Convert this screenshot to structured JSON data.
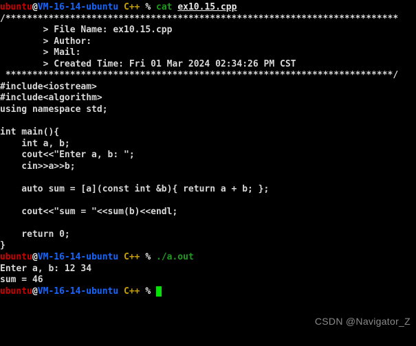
{
  "terminal": {
    "background_color": "#000000",
    "foreground_color": "#d8d8d8",
    "cursor_color": "#00e500",
    "colors": {
      "user": "#cc0000",
      "host": "#1565ff",
      "dir": "#c8a000",
      "command": "#1f9c1f",
      "text": "#e0e0e0"
    },
    "prompt": {
      "user": "ubuntu",
      "at": "@",
      "host": "VM-16-14-ubuntu",
      "dir": "C++",
      "symbol": "%"
    },
    "commands": {
      "cat": "cat",
      "cat_arg": "ex10.15.cpp",
      "run": "./a.out"
    },
    "source_file": {
      "header_open": "/*************************************************************************",
      "header_lines": [
        "        > File Name: ex10.15.cpp",
        "        > Author: ",
        "        > Mail: ",
        "        > Created Time: Fri 01 Mar 2024 02:34:26 PM CST"
      ],
      "header_close": " ************************************************************************/",
      "code_lines": [
        "#include<iostream>",
        "#include<algorithm>",
        "using namespace std;",
        "",
        "int main(){",
        "    int a, b;",
        "    cout<<\"Enter a, b: \";",
        "    cin>>a>>b;",
        "",
        "    auto sum = [a](const int &b){ return a + b; };",
        "",
        "    cout<<\"sum = \"<<sum(b)<<endl;",
        "",
        "    return 0;",
        "}"
      ]
    },
    "program_output": [
      "Enter a, b: 12 34",
      "sum = 46"
    ]
  },
  "watermark": {
    "text": "CSDN @Navigator_Z"
  }
}
